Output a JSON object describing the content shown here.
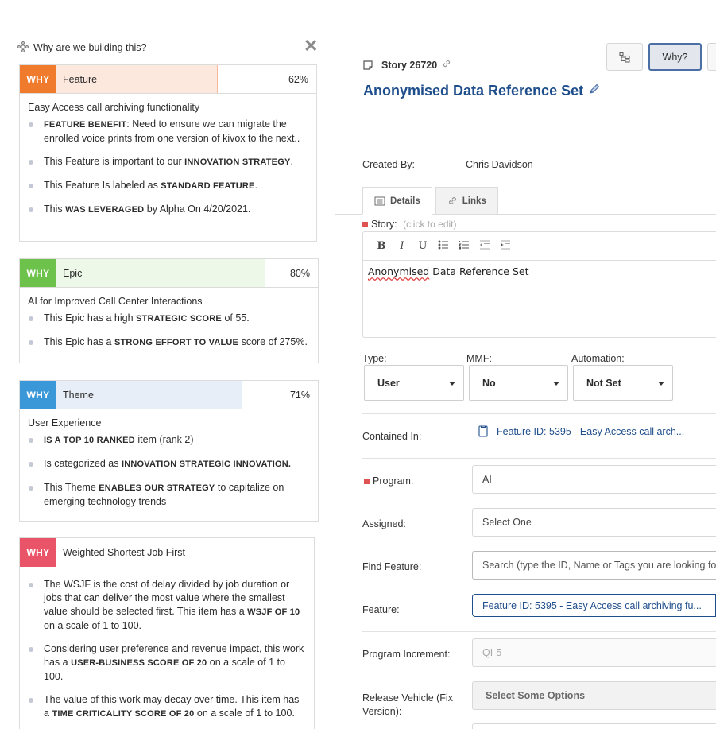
{
  "why_panel": {
    "title": "Why are we building this?",
    "cards": [
      {
        "tag": "WHY",
        "tag_color": "#f07b2c",
        "fill_color": "#fde8dd",
        "fill_border": "#f4b99a",
        "title": "Feature",
        "percent": "62%",
        "percent_value": 0.62,
        "subtitle": "Easy Access call archiving functionality",
        "items": [
          [
            {
              "b": "FEATURE BENEFIT"
            },
            {
              "t": ": Need to ensure we can migrate the enrolled voice prints from one version of kivox to the next.."
            }
          ],
          [
            {
              "t": "This Feature is important to our "
            },
            {
              "b": "INNOVATION STRATEGY"
            },
            {
              "t": "."
            }
          ],
          [
            {
              "t": "This Feature Is labeled as "
            },
            {
              "b": "STANDARD FEATURE"
            },
            {
              "t": "."
            }
          ],
          [
            {
              "t": "This "
            },
            {
              "b": "WAS LEVERAGED"
            },
            {
              "t": " by Alpha On 4/20/2021."
            }
          ]
        ]
      },
      {
        "tag": "WHY",
        "tag_color": "#6cc24a",
        "fill_color": "#eef8e8",
        "fill_border": "#8fd26e",
        "title": "Epic",
        "percent": "80%",
        "percent_value": 0.8,
        "subtitle": "AI for Improved Call Center Interactions",
        "items": [
          [
            {
              "t": "This Epic has a high "
            },
            {
              "b": "STRATEGIC SCORE"
            },
            {
              "t": " of 55."
            }
          ],
          [
            {
              "t": "This Epic has a "
            },
            {
              "b": "STRONG EFFORT TO VALUE"
            },
            {
              "t": " score of 275%."
            }
          ]
        ]
      },
      {
        "tag": "WHY",
        "tag_color": "#3a97d8",
        "fill_color": "#e8eef7",
        "fill_border": "#8cb8e0",
        "title": "Theme",
        "percent": "71%",
        "percent_value": 0.71,
        "subtitle": "User Experience",
        "items": [
          [
            {
              "b": "IS A TOP 10 RANKED"
            },
            {
              "t": " item (rank 2)"
            }
          ],
          [
            {
              "t": "Is categorized as "
            },
            {
              "b": "INNOVATION STRATEGIC INNOVATION."
            }
          ],
          [
            {
              "t": "This Theme "
            },
            {
              "b": "ENABLES OUR STRATEGY"
            },
            {
              "t": " to capitalize on emerging technology trends"
            }
          ]
        ]
      },
      {
        "tag": "WHY",
        "tag_color": "#ea5468",
        "fill_color": "#ffffff",
        "fill_border": "#ffffff",
        "title": "Weighted Shortest Job First",
        "percent": "",
        "percent_value": 0,
        "subtitle": "",
        "items": [
          [
            {
              "t": "The WSJF is the cost of delay divided by job duration or jobs that can deliver the most value where the smallest value should be selected first. This item has a "
            },
            {
              "b": "WSJF OF 10"
            },
            {
              "t": " on a scale of 1 to 100."
            }
          ],
          [
            {
              "t": "Considering user preference and revenue impact, this work has a "
            },
            {
              "b": "USER-BUSINESS SCORE OF 20"
            },
            {
              "t": " on a scale of 1 to 100."
            }
          ],
          [
            {
              "t": "The value of this work may decay over time. This item has a "
            },
            {
              "b": "TIME CRITICALITY SCORE OF 20"
            },
            {
              "t": " on a scale of 1 to 100."
            }
          ]
        ]
      }
    ]
  },
  "story": {
    "toolbar": {
      "why_label": "Why?"
    },
    "id_label": "Story 26720",
    "title": "Anonymised Data Reference Set",
    "created_by_label": "Created By:",
    "created_by": "Chris Davidson",
    "tabs": [
      "Details",
      "Links"
    ],
    "story_label": "Story:",
    "click_to_edit": "(click to edit)",
    "editor_text_misspelled": "Anonymised",
    "editor_text_rest": " Data Reference Set",
    "type_label": "Type:",
    "type_value": "User",
    "mmf_label": "MMF:",
    "mmf_value": "No",
    "automation_label": "Automation:",
    "automation_value": "Not Set",
    "contained_in_label": "Contained In:",
    "contained_in_value": "Feature ID: 5395 - Easy Access call arch...",
    "program_label": "Program:",
    "program_value": "AI",
    "assigned_label": "Assigned:",
    "assigned_value": "Select One",
    "find_feature_label": "Find Feature:",
    "find_feature_placeholder": "Search (type the ID, Name or Tags you are looking for)",
    "feature_label": "Feature:",
    "feature_value": "Feature ID: 5395 - Easy Access call archiving fu...",
    "pi_label": "Program Increment:",
    "pi_value": "QI-5",
    "release_label": "Release Vehicle (Fix Version):",
    "release_value": "Select Some Options"
  }
}
